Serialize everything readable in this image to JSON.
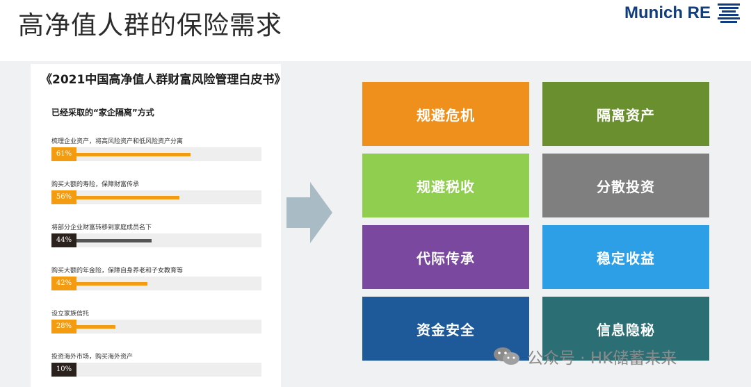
{
  "slide": {
    "title": "高净值人群的保险需求"
  },
  "brand": {
    "name": "Munich RE",
    "color": "#0f3d7d"
  },
  "report": {
    "title": "《2021中国高净值人群财富风险管理白皮书》",
    "subtitle": "已经采取的“家企隔离”方式",
    "items": [
      {
        "label": "梳理企业资产，将高风险资产和低风险资产分离",
        "pct_text": "61%",
        "value": 61,
        "style": "orange"
      },
      {
        "label": "购买大额的寿险，保障财富传承",
        "pct_text": "56%",
        "value": 56,
        "style": "orange"
      },
      {
        "label": "将部分企业财富转移到家庭成员名下",
        "pct_text": "44%",
        "value": 44,
        "style": "dark"
      },
      {
        "label": "购买大额的年金险，保障自身养老和子女教育等",
        "pct_text": "42%",
        "value": 42,
        "style": "orange"
      },
      {
        "label": "设立家族信托",
        "pct_text": "28%",
        "value": 28,
        "style": "orange"
      },
      {
        "label": "投资海外市场，购买海外资产",
        "pct_text": "10%",
        "value": 10,
        "style": "dark"
      }
    ]
  },
  "arrow": {
    "icon": "right-arrow-icon",
    "color": "#a9bcc6"
  },
  "tiles": [
    {
      "label": "规避危机",
      "color": "#f0901c"
    },
    {
      "label": "隔离资产",
      "color": "#6a8f2f"
    },
    {
      "label": "规避税收",
      "color": "#8fce4f"
    },
    {
      "label": "分散投资",
      "color": "#7f7f7f"
    },
    {
      "label": "代际传承",
      "color": "#7a489e"
    },
    {
      "label": "稳定收益",
      "color": "#2d9fe6"
    },
    {
      "label": "资金安全",
      "color": "#1e5a99"
    },
    {
      "label": "信息隐秘",
      "color": "#2b6f75"
    }
  ],
  "watermark": {
    "text": "公众号 · HK储蓄未来",
    "icon": "wechat-icon"
  }
}
